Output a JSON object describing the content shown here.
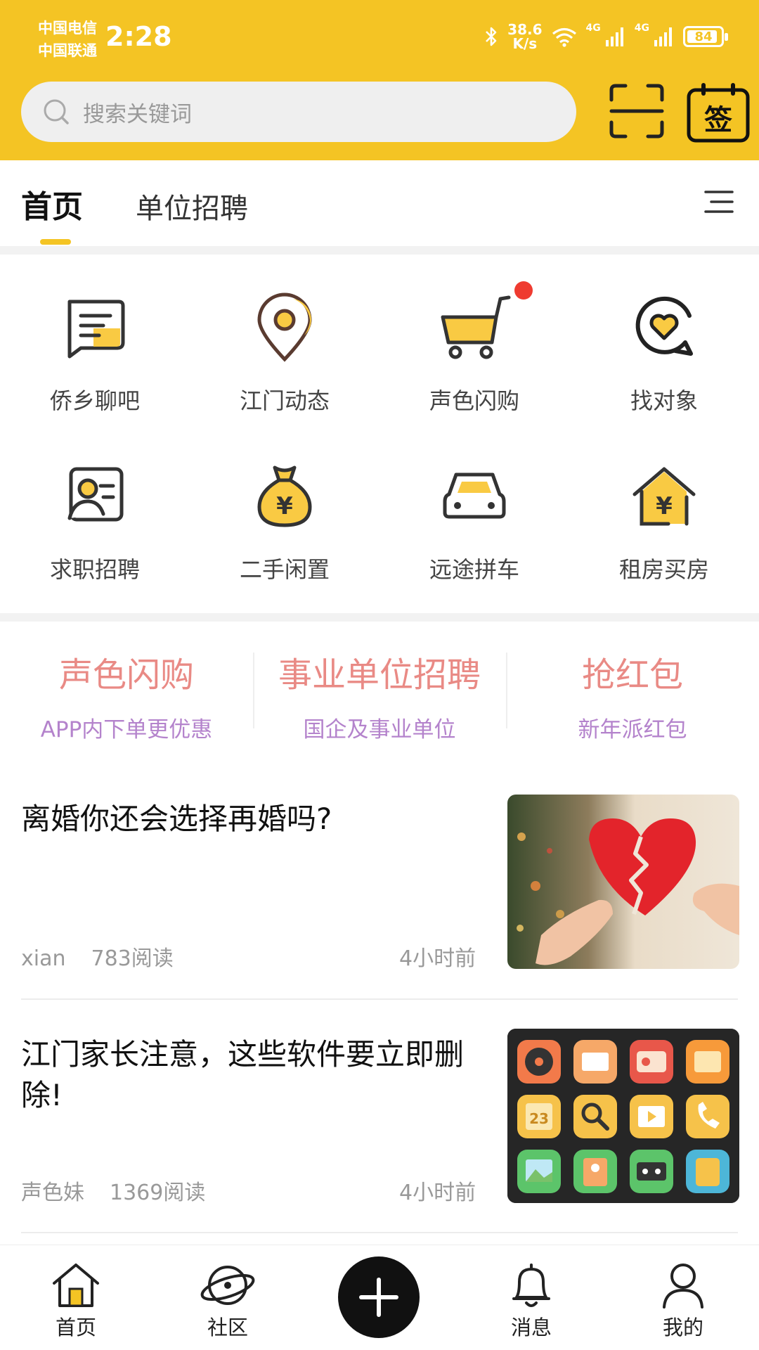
{
  "status_bar": {
    "carrier1": "中国电信",
    "carrier2": "中国联通",
    "time": "2:28",
    "speed_top": "38.6",
    "speed_unit": "K/s",
    "net1": "4G",
    "net2": "4G",
    "battery": "84"
  },
  "header": {
    "search_placeholder": "搜索关键词",
    "sign_label": "签"
  },
  "tabs": [
    {
      "label": "首页",
      "active": true
    },
    {
      "label": "单位招聘",
      "active": false
    }
  ],
  "grid": [
    {
      "label": "侨乡聊吧",
      "icon": "chat-icon"
    },
    {
      "label": "江门动态",
      "icon": "location-pin-icon"
    },
    {
      "label": "声色闪购",
      "icon": "shopping-cart-icon",
      "badge": true
    },
    {
      "label": "找对象",
      "icon": "heart-bubble-icon"
    },
    {
      "label": "求职招聘",
      "icon": "id-card-icon"
    },
    {
      "label": "二手闲置",
      "icon": "money-bag-icon"
    },
    {
      "label": "远途拼车",
      "icon": "car-icon"
    },
    {
      "label": "租房买房",
      "icon": "house-yuan-icon"
    }
  ],
  "promos": [
    {
      "title": "声色闪购",
      "subtitle": "APP内下单更优惠"
    },
    {
      "title": "事业单位招聘",
      "subtitle": "国企及事业单位"
    },
    {
      "title": "抢红包",
      "subtitle": "新年派红包"
    }
  ],
  "articles": [
    {
      "title": "离婚你还会选择再婚吗?",
      "author": "xian",
      "reads": "783阅读",
      "time": "4小时前",
      "image": "broken-heart-image"
    },
    {
      "title": "江门家长注意，这些软件要立即删除!",
      "author": "声色妹",
      "reads": "1369阅读",
      "time": "4小时前",
      "image": "app-icons-image"
    }
  ],
  "bottom_nav": [
    {
      "label": "首页",
      "icon": "home-icon"
    },
    {
      "label": "社区",
      "icon": "planet-icon"
    },
    {
      "label": "",
      "icon": "plus-icon"
    },
    {
      "label": "消息",
      "icon": "bell-icon"
    },
    {
      "label": "我的",
      "icon": "user-icon"
    }
  ],
  "colors": {
    "brand_yellow": "#f4c424",
    "promo_title": "#e98a85",
    "promo_subtitle": "#b483cc"
  }
}
